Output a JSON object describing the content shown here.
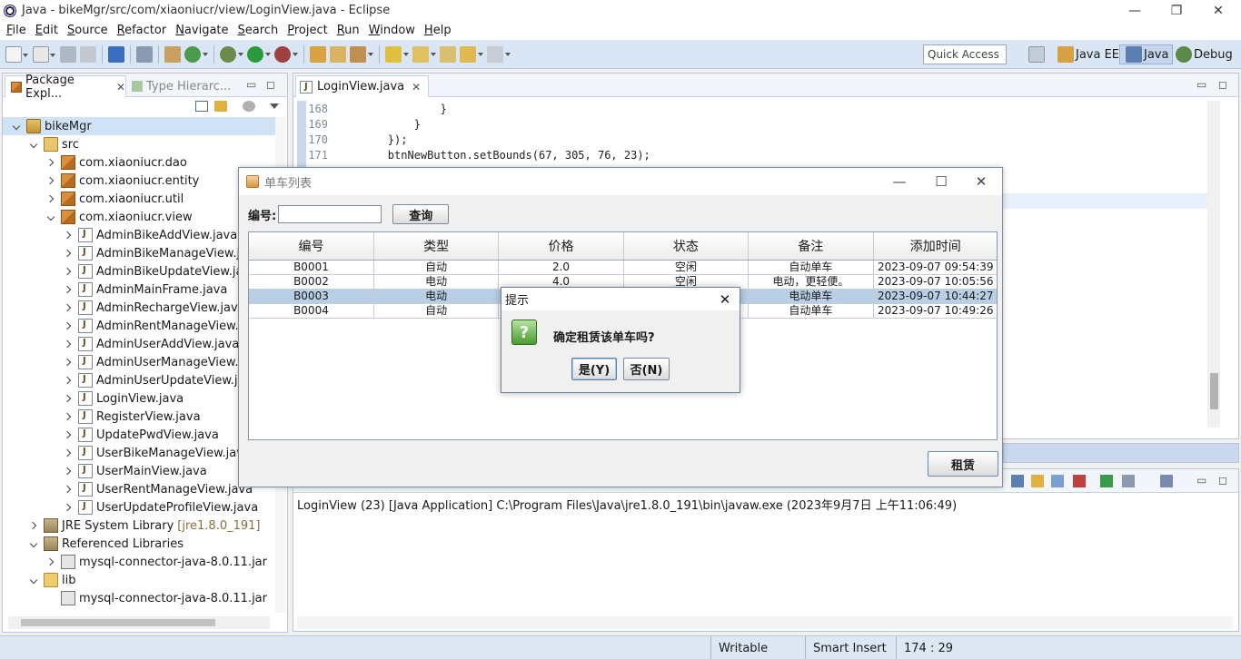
{
  "window": {
    "title": "Java - bikeMgr/src/com/xiaoniucr/view/LoginView.java - Eclipse",
    "minimize_glyph": "—",
    "restore_glyph": "❐",
    "close_glyph": "✕"
  },
  "menu": [
    "File",
    "Edit",
    "Source",
    "Refactor",
    "Navigate",
    "Search",
    "Project",
    "Run",
    "Window",
    "Help"
  ],
  "toolbar": {
    "quick_access": "Quick Access",
    "perspectives": [
      "Java EE",
      "Java",
      "Debug"
    ]
  },
  "package_explorer": {
    "tab_label": "Package Expl...",
    "tab_close": "✕",
    "second_tab": "Type Hierarc...",
    "tree": [
      {
        "label": "bikeMgr",
        "depth": 0,
        "expand": "open",
        "icon": "project-icon",
        "selected": true
      },
      {
        "label": "src",
        "depth": 1,
        "expand": "open",
        "icon": "source-folder-icon"
      },
      {
        "label": "com.xiaoniucr.dao",
        "depth": 2,
        "expand": "closed",
        "icon": "package-icon"
      },
      {
        "label": "com.xiaoniucr.entity",
        "depth": 2,
        "expand": "closed",
        "icon": "package-icon"
      },
      {
        "label": "com.xiaoniucr.util",
        "depth": 2,
        "expand": "closed",
        "icon": "package-icon"
      },
      {
        "label": "com.xiaoniucr.view",
        "depth": 2,
        "expand": "open",
        "icon": "package-icon"
      },
      {
        "label": "AdminBikeAddView.java",
        "depth": 3,
        "expand": "closed",
        "icon": "java-file-icon"
      },
      {
        "label": "AdminBikeManageView.java",
        "depth": 3,
        "expand": "closed",
        "icon": "java-file-icon"
      },
      {
        "label": "AdminBikeUpdateView.java",
        "depth": 3,
        "expand": "closed",
        "icon": "java-file-icon"
      },
      {
        "label": "AdminMainFrame.java",
        "depth": 3,
        "expand": "closed",
        "icon": "java-file-icon"
      },
      {
        "label": "AdminRechargeView.java",
        "depth": 3,
        "expand": "closed",
        "icon": "java-file-icon"
      },
      {
        "label": "AdminRentManageView.java",
        "depth": 3,
        "expand": "closed",
        "icon": "java-file-icon"
      },
      {
        "label": "AdminUserAddView.java",
        "depth": 3,
        "expand": "closed",
        "icon": "java-file-icon"
      },
      {
        "label": "AdminUserManageView.java",
        "depth": 3,
        "expand": "closed",
        "icon": "java-file-icon"
      },
      {
        "label": "AdminUserUpdateView.java",
        "depth": 3,
        "expand": "closed",
        "icon": "java-file-icon"
      },
      {
        "label": "LoginView.java",
        "depth": 3,
        "expand": "closed",
        "icon": "java-file-icon"
      },
      {
        "label": "RegisterView.java",
        "depth": 3,
        "expand": "closed",
        "icon": "java-file-icon"
      },
      {
        "label": "UpdatePwdView.java",
        "depth": 3,
        "expand": "closed",
        "icon": "java-file-icon"
      },
      {
        "label": "UserBikeManageView.java",
        "depth": 3,
        "expand": "closed",
        "icon": "java-file-icon"
      },
      {
        "label": "UserMainView.java",
        "depth": 3,
        "expand": "closed",
        "icon": "java-file-icon"
      },
      {
        "label": "UserRentManageView.java",
        "depth": 3,
        "expand": "closed",
        "icon": "java-file-icon"
      },
      {
        "label": "UserUpdateProfileView.java",
        "depth": 3,
        "expand": "closed",
        "icon": "java-file-icon"
      },
      {
        "label": "JRE System Library",
        "suffix": "[jre1.8.0_191]",
        "depth": 1,
        "expand": "closed",
        "icon": "library-icon"
      },
      {
        "label": "Referenced Libraries",
        "depth": 1,
        "expand": "open",
        "icon": "library-icon"
      },
      {
        "label": "mysql-connector-java-8.0.11.jar",
        "depth": 2,
        "expand": "closed",
        "icon": "jar-icon"
      },
      {
        "label": "lib",
        "depth": 1,
        "expand": "open",
        "icon": "folder-icon"
      },
      {
        "label": "mysql-connector-java-8.0.11.jar",
        "depth": 2,
        "expand": "none",
        "icon": "jar-icon"
      }
    ]
  },
  "editor": {
    "tab_label": "LoginView.java",
    "tab_close": "✕",
    "lines": [
      {
        "no": "168",
        "text": "                }"
      },
      {
        "no": "169",
        "text": "            }"
      },
      {
        "no": "170",
        "text": "        });"
      },
      {
        "no": "171",
        "text": "        btnNewButton.setBounds(67, 305, 76, 23);"
      }
    ]
  },
  "console": {
    "text": "LoginView (23) [Java Application] C:\\Program Files\\Java\\jre1.8.0_191\\bin\\javaw.exe (2023年9月7日 上午11:06:49)"
  },
  "statusbar": {
    "writable": "Writable",
    "insert_mode": "Smart Insert",
    "position": "174 : 29"
  },
  "bike_window": {
    "title": "单车列表",
    "search_label": "编号:",
    "search_value": "",
    "query_button": "查询",
    "rent_button": "租赁",
    "columns": [
      "编号",
      "类型",
      "价格",
      "状态",
      "备注",
      "添加时间"
    ],
    "rows": [
      {
        "id": "B0001",
        "type": "自动",
        "price": "2.0",
        "status": "空闲",
        "note": "自动单车",
        "time": "2023-09-07 09:54:39"
      },
      {
        "id": "B0002",
        "type": "电动",
        "price": "4.0",
        "status": "空闲",
        "note": "电动，更轻便。",
        "time": "2023-09-07 10:05:56"
      },
      {
        "id": "B0003",
        "type": "电动",
        "price": "",
        "status": "",
        "note": "电动单车",
        "time": "2023-09-07 10:44:27"
      },
      {
        "id": "B0004",
        "type": "自动",
        "price": "",
        "status": "",
        "note": "自动单车",
        "time": "2023-09-07 10:49:26"
      }
    ],
    "selected_row": 2
  },
  "dialog": {
    "title": "提示",
    "message": "确定租赁该单车吗?",
    "yes_button": "是(Y)",
    "no_button": "否(N)",
    "icon_glyph": "?",
    "close_glyph": "✕"
  }
}
